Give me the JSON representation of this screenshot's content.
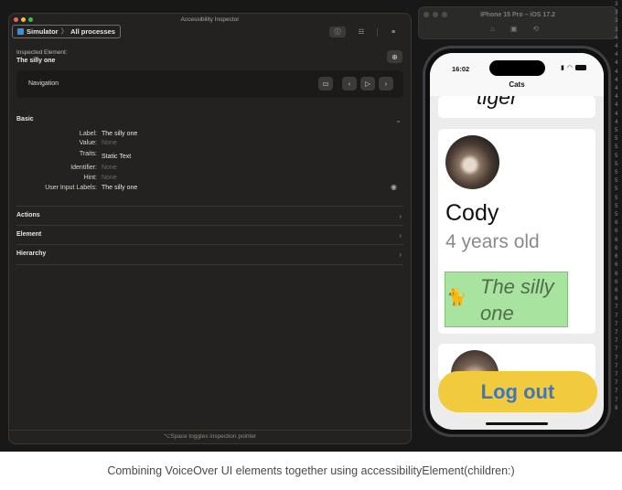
{
  "caption": "Combining VoiceOver UI elements together using accessibilityElement(children:)",
  "inspector": {
    "window_title": "Accessibility Inspector",
    "breadcrumb": {
      "target": "Simulator",
      "separator": "〉",
      "scope": "All processes"
    },
    "inspected_label": "Inspected Element:",
    "inspected_value": "The silly one",
    "navigation_label": "Navigation",
    "sections": {
      "basic": "Basic",
      "actions": "Actions",
      "element": "Element",
      "hierarchy": "Hierarchy"
    },
    "basic": {
      "label_key": "Label:",
      "label_value": "The silly one",
      "value_key": "Value:",
      "value_value": "None",
      "traits_key": "Traits:",
      "traits_value": "Static Text",
      "identifier_key": "Identifier:",
      "identifier_value": "None",
      "hint_key": "Hint:",
      "hint_value": "None",
      "user_input_key": "User Input Labels:",
      "user_input_value": "The silly one"
    },
    "footer": "⌥Space toggles inspection pointer",
    "traffic_lights": [
      "#fe5f57",
      "#febc2e",
      "#28c840"
    ]
  },
  "simulator": {
    "title": "iPhone 15 Pro – iOS 17.2"
  },
  "phone": {
    "time": "16:02",
    "nav_title": "Cats",
    "top_card_text": "tiger",
    "cat_name": "Cody",
    "cat_age": "4 years old",
    "accessibility_label": "The silly one",
    "logout_label": "Log out"
  },
  "gutter_numbers": [
    "3",
    "3",
    "3",
    "3",
    "4",
    "4",
    "4",
    "4",
    "4",
    "4",
    "4",
    "4",
    "4",
    "4",
    "4",
    "5",
    "5",
    "5",
    "5",
    "5",
    "5",
    "5",
    "5",
    "5",
    "5",
    "5",
    "6",
    "6",
    "6",
    "6",
    "6",
    "6",
    "6",
    "6",
    "6",
    "6",
    "7",
    "7",
    "7",
    "7",
    "7",
    "7",
    "7",
    "7",
    "7",
    "7",
    "7",
    "7",
    "8"
  ]
}
